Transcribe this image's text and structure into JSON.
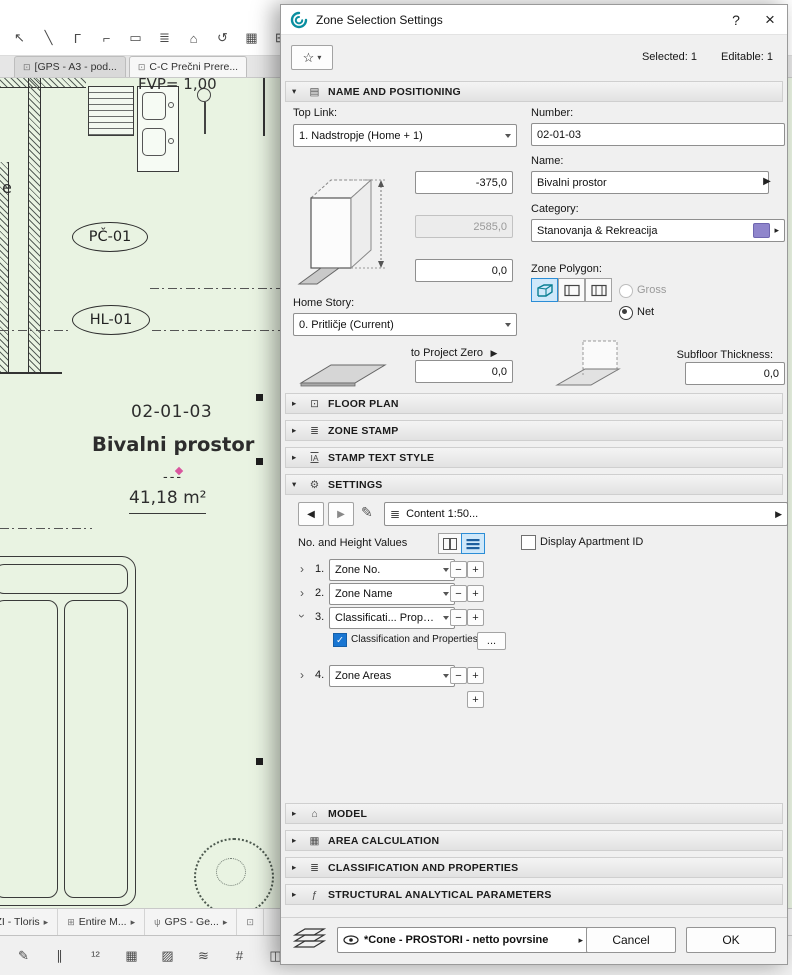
{
  "colors": {
    "accent_blue": "#2b8dd6",
    "selected_bg": "#cfe8fa",
    "category_swatch": "#8f85cc",
    "canvas_green": "#e9f3e2",
    "teal": "#0a8fa0"
  },
  "icons": {
    "help": "?",
    "close": "×",
    "star": "☆",
    "caret": "▾",
    "chevron": "›",
    "tri_left": "◀",
    "tri_right": "▶",
    "tri_small": "▸",
    "plus": "+",
    "minus": "−",
    "check": "✓",
    "pencil": "✎",
    "list": "≣",
    "gear": "⚙",
    "house": "⌂",
    "grid": "▦",
    "page": "▤",
    "fx": "ƒ",
    "text_style": "IA",
    "stamp": "≣",
    "psi": "ψ",
    "square": "⊡",
    "plus_box": "⊞"
  },
  "canvas": {
    "toolbar_top": [
      "↖",
      "╲",
      "Γ",
      "⌐",
      "▭",
      "≣",
      "⌂",
      "↺",
      "▦",
      "⊞"
    ],
    "toolbar_top_selected": "▣",
    "tabs": [
      {
        "label": "[GPS - A3 - pod..."
      },
      {
        "label": "C-C Prečni Prere..."
      }
    ],
    "plan": {
      "fvp": "FVP= 1,00",
      "partial_letter": "e",
      "tag1": "PČ-01",
      "tag2": "HL-01",
      "zone_number": "02-01-03",
      "zone_name": "Bivalni prostor",
      "zone_sep": "---",
      "zone_area": "41,18 m²"
    },
    "bottom_tabs": [
      "ZI - Tloris",
      "Entire M...",
      "GPS - Ge..."
    ],
    "toolbar_bottom": [
      "✎",
      "∥",
      "¹²",
      "▦",
      "▨",
      "≋",
      "#",
      "◫"
    ]
  },
  "dialog": {
    "title": "Zone Selection Settings",
    "selected_label": "Selected: 1",
    "editable_label": "Editable: 1",
    "sections": {
      "name_positioning": "NAME AND POSITIONING",
      "floor_plan": "FLOOR PLAN",
      "zone_stamp": "ZONE STAMP",
      "stamp_text_style": "STAMP TEXT STYLE",
      "settings": "SETTINGS",
      "model": "MODEL",
      "area_calculation": "AREA CALCULATION",
      "classification_properties": "CLASSIFICATION AND PROPERTIES",
      "structural": "STRUCTURAL ANALYTICAL PARAMETERS"
    },
    "nap": {
      "top_link_label": "Top Link:",
      "top_link_value": "1. Nadstropje (Home + 1)",
      "offset_top": "-375,0",
      "height": "2585,0",
      "offset_mid": "0,0",
      "home_story_label": "Home Story:",
      "home_story_value": "0. Pritličje (Current)",
      "to_project_zero": "to Project Zero",
      "offset_bottom": "0,0",
      "number_label": "Number:",
      "number": "02-01-03",
      "name_label": "Name:",
      "name": "Bivalni prostor",
      "category_label": "Category:",
      "category": "Stanovanja & Rekreacija",
      "zone_polygon_label": "Zone Polygon:",
      "gross": "Gross",
      "net": "Net",
      "subfloor_label": "Subfloor Thickness:",
      "subfloor": "0,0"
    },
    "settings": {
      "content_value": "Content 1:50...",
      "values_label": "No. and Height Values",
      "apartment_label": "Display Apartment ID",
      "rows": [
        {
          "n": "1.",
          "v": "Zone No."
        },
        {
          "n": "2.",
          "v": "Zone Name"
        },
        {
          "n": "3.",
          "v": "Classificati... Properties"
        },
        {
          "n": "4.",
          "v": "Zone Areas"
        }
      ],
      "class_checkbox_label": "Classification and Properties",
      "more_label": "..."
    },
    "footer": {
      "layer_combo": "*Cone - PROSTORI - netto povrsine",
      "cancel": "Cancel",
      "ok": "OK"
    }
  }
}
